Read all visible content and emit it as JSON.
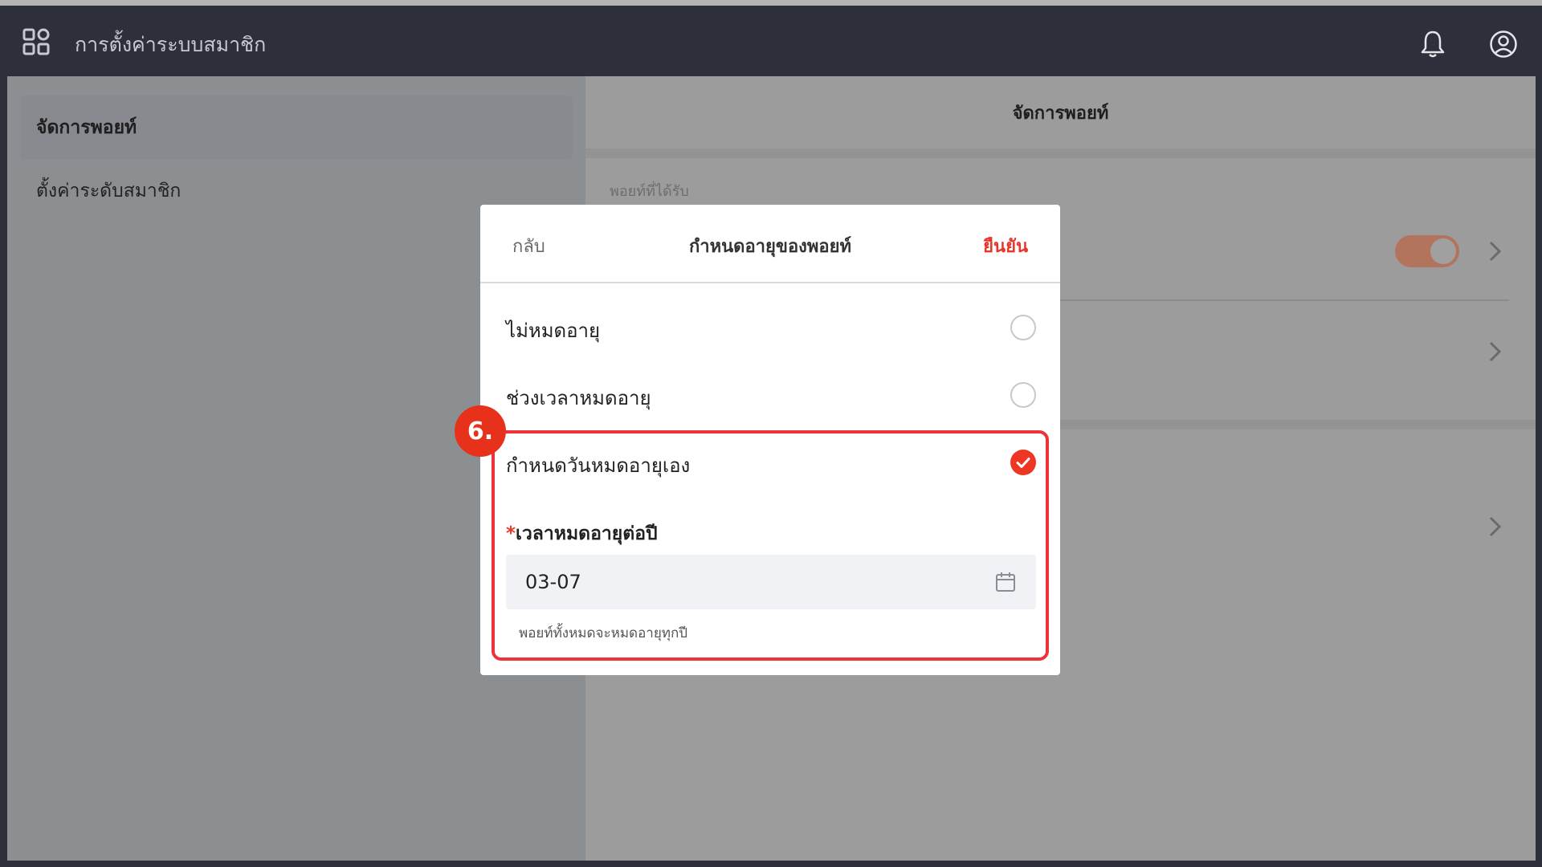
{
  "app": {
    "title": "การตั้งค่าระบบสมาชิก"
  },
  "sidebar": {
    "items": [
      {
        "label": "จัดการพอยท์",
        "active": true
      },
      {
        "label": "ตั้งค่าระดับสมาชิก",
        "active": false
      }
    ]
  },
  "main": {
    "header_title": "จัดการพอยท์",
    "section_label": "พอยท์ที่ได้รับ",
    "toggle_on": true
  },
  "modal": {
    "back_label": "กลับ",
    "title": "กำหนดอายุของพอยท์",
    "confirm_label": "ยืนยัน",
    "options": [
      {
        "label": "ไม่หมดอายุ",
        "selected": false
      },
      {
        "label": "ช่วงเวลาหมดอายุ",
        "selected": false
      },
      {
        "label": "กำหนดวันหมดอายุเอง",
        "selected": true
      }
    ],
    "field": {
      "required_mark": "*",
      "label": "เวลาหมดอายุต่อปี",
      "value": "03-07",
      "hint": "พอยท์ทั้งหมดจะหมดอายุทุกปี"
    }
  },
  "annotation": {
    "step": "6."
  },
  "colors": {
    "accent": "#e8352a",
    "topbar": "#2d2f3a",
    "overlay": "#9c9c9c",
    "toggle": "#b2745c"
  },
  "icons": [
    "apps-grid-icon",
    "bell-icon",
    "user-circle-icon",
    "chevron-right-icon",
    "calendar-icon",
    "check-icon"
  ]
}
